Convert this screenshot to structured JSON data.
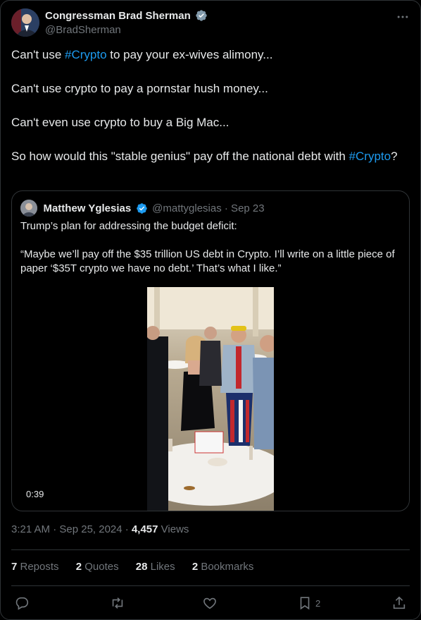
{
  "author": {
    "name": "Congressman Brad Sherman",
    "handle": "@BradSherman"
  },
  "tweet": {
    "line1_pre": "Can't use ",
    "line1_tag": "#Crypto",
    "line1_post": " to pay your ex-wives alimony...",
    "line2": "Can't use crypto to pay a pornstar hush money...",
    "line3": "Can't even use crypto to buy a Big Mac...",
    "line4_pre": "So how would this \"stable genius\" pay off the national debt with ",
    "line4_tag": "#Crypto",
    "line4_post": "?"
  },
  "quote": {
    "name": "Matthew Yglesias",
    "handle_date": "@mattyglesias · Sep 23",
    "para1": "Trump’s plan for addressing the budget deficit:",
    "para2": "“Maybe we’ll pay off the $35 trillion US debt in Crypto. I’ll write on a little piece of paper ‘$35T crypto we have no debt.’ That’s what I like.”",
    "video_duration": "0:39"
  },
  "meta": {
    "time_date": "3:21 AM · Sep 25, 2024 · ",
    "views_count": "4,457",
    "views_label": " Views"
  },
  "stats": {
    "reposts_count": "7",
    "reposts_label": " Reposts",
    "quotes_count": "2",
    "quotes_label": " Quotes",
    "likes_count": "28",
    "likes_label": " Likes",
    "bookmarks_count": "2",
    "bookmarks_label": " Bookmarks"
  },
  "actions": {
    "bookmark_count": "2"
  },
  "colors": {
    "accent": "#1d9bf0",
    "muted": "#71767b",
    "border": "#2f3336",
    "background": "#000000"
  },
  "icons": [
    "verified-badge-icon",
    "more-icon",
    "reply-icon",
    "retweet-icon",
    "like-icon",
    "bookmark-icon",
    "share-icon"
  ]
}
